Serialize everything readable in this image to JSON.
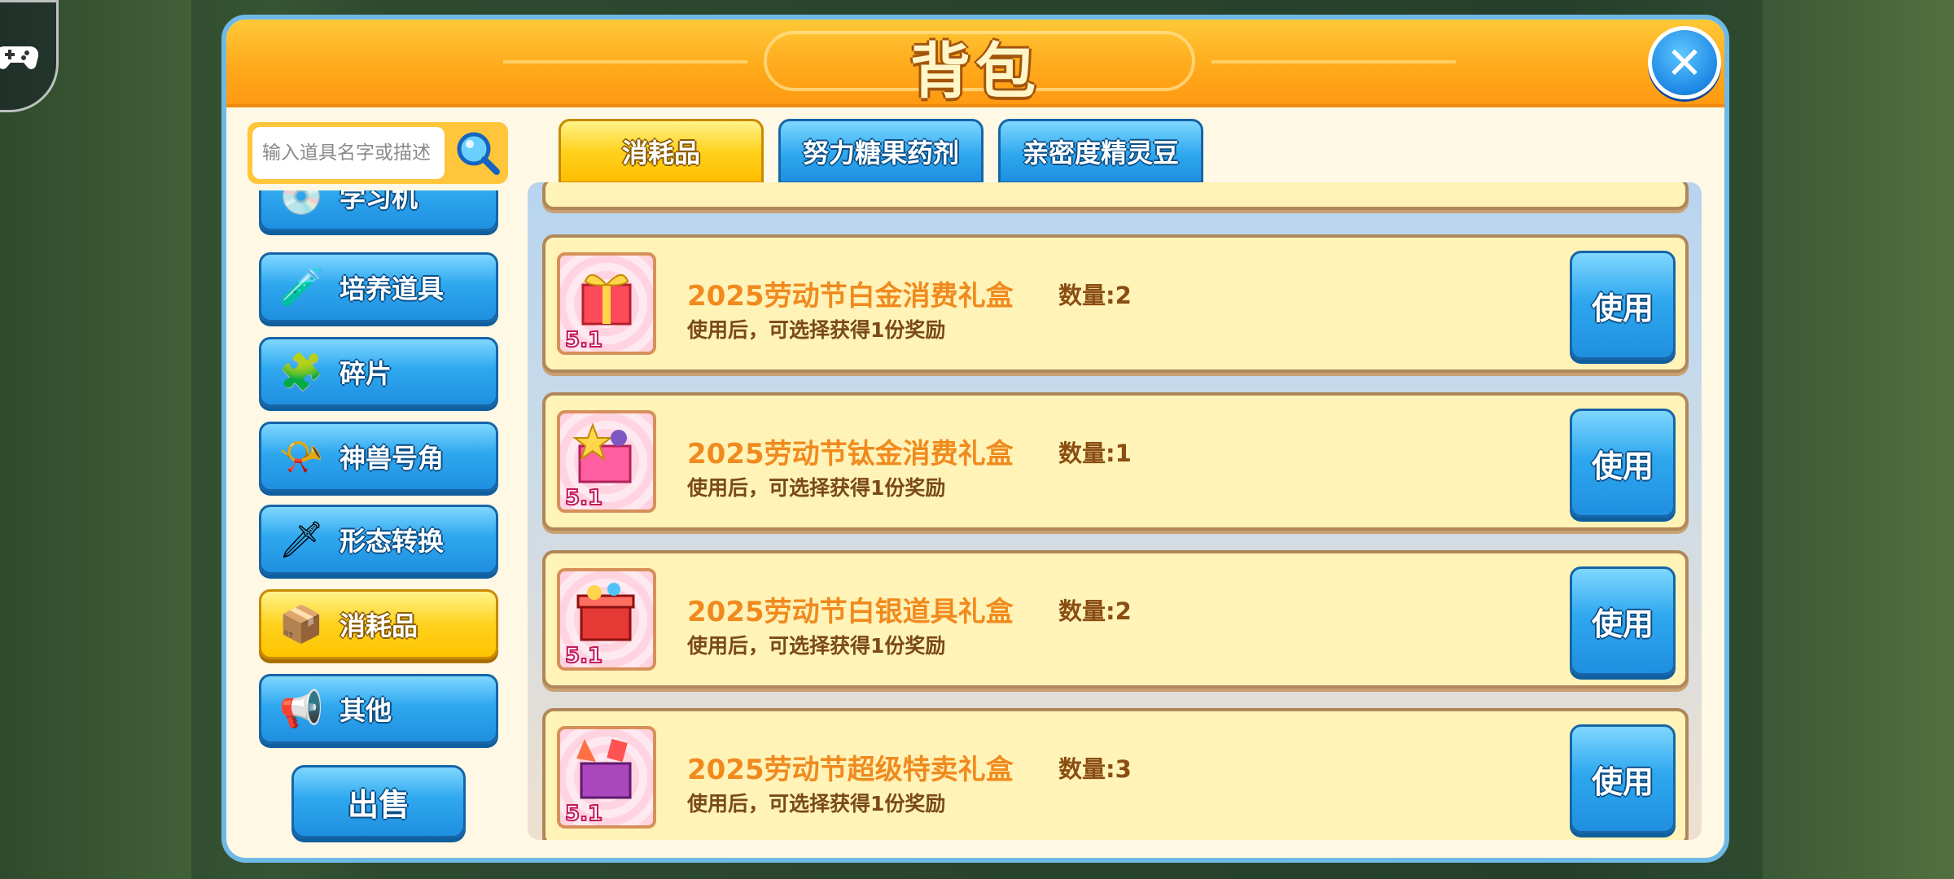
{
  "window": {
    "title": "背包"
  },
  "search": {
    "placeholder": "输入道具名字或描述"
  },
  "tabs": [
    {
      "label": "消耗品",
      "active": true
    },
    {
      "label": "努力糖果药剂",
      "active": false
    },
    {
      "label": "亲密度精灵豆",
      "active": false
    }
  ],
  "categories": [
    {
      "label": "学习机",
      "icon": "disc-icon",
      "active": false
    },
    {
      "label": "培养道具",
      "icon": "potion-icon",
      "active": false
    },
    {
      "label": "碎片",
      "icon": "puzzle-icon",
      "active": false
    },
    {
      "label": "神兽号角",
      "icon": "horn-icon",
      "active": false
    },
    {
      "label": "形态转换",
      "icon": "shard-icon",
      "active": false
    },
    {
      "label": "消耗品",
      "icon": "box-icon",
      "active": true
    },
    {
      "label": "其他",
      "icon": "megaphone-icon",
      "active": false
    }
  ],
  "sell_button": "出售",
  "items": [
    {
      "name": "2025劳动节白金消费礼盒",
      "quantity": "数量:2",
      "description": "使用后，可选择获得1份奖励",
      "use_label": "使用"
    },
    {
      "name": "2025劳动节钛金消费礼盒",
      "quantity": "数量:1",
      "description": "使用后，可选择获得1份奖励",
      "use_label": "使用"
    },
    {
      "name": "2025劳动节白银道具礼盒",
      "quantity": "数量:2",
      "description": "使用后，可选择获得1份奖励",
      "use_label": "使用"
    },
    {
      "name": "2025劳动节超级特卖礼盒",
      "quantity": "数量:3",
      "description": "使用后，可选择获得1份奖励",
      "use_label": "使用"
    }
  ],
  "item_badge": "5.1",
  "colors": {
    "accent_orange": "#ffa81a",
    "button_blue": "#2fa8ef",
    "active_yellow": "#ffd21e",
    "item_name": "#f08a1e"
  }
}
